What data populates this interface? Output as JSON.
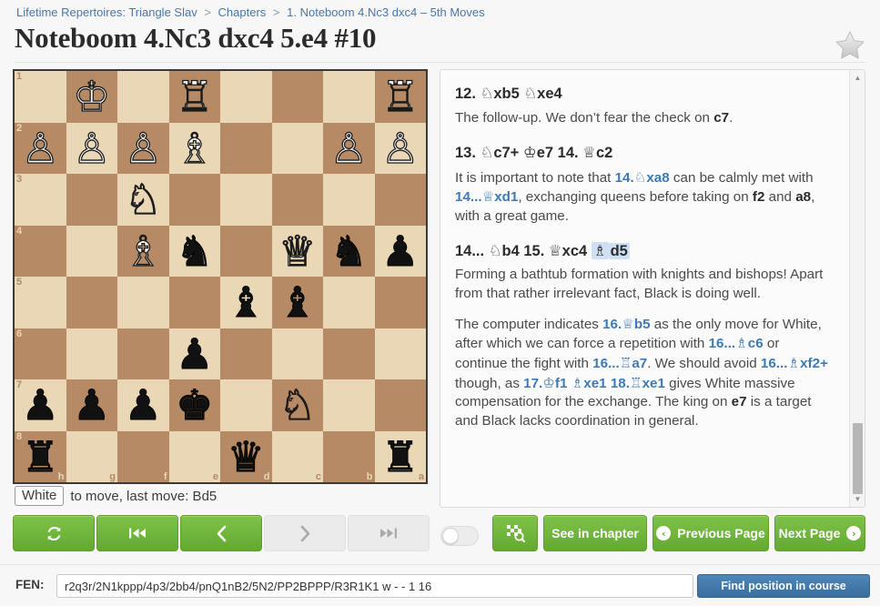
{
  "breadcrumb": {
    "items": [
      "Lifetime Repertoires: Triangle Slav",
      "Chapters",
      "1. Noteboom 4.Nc3 dxc4 – 5th Moves"
    ],
    "separator": ">"
  },
  "header": {
    "title": "Noteboom 4.Nc3 dxc4 5.e4 #10",
    "star_icon": "star-icon"
  },
  "board": {
    "orientation": "black",
    "light_color": "#e9d7b6",
    "dark_color": "#b58a64",
    "rank_labels": [
      "1",
      "2",
      "3",
      "4",
      "5",
      "6",
      "7",
      "8"
    ],
    "file_labels": [
      "h",
      "g",
      "f",
      "e",
      "d",
      "c",
      "b",
      "a"
    ],
    "rows": [
      [
        ".",
        "K",
        ".",
        "R",
        ".",
        ".",
        ".",
        "R"
      ],
      [
        "P",
        "P",
        "P",
        "B",
        ".",
        ".",
        "P",
        "P"
      ],
      [
        ".",
        ".",
        "N",
        ".",
        ".",
        ".",
        ".",
        "."
      ],
      [
        ".",
        ".",
        "B",
        "n",
        ".",
        "Q",
        "n",
        "p"
      ],
      [
        ".",
        ".",
        ".",
        ".",
        "b",
        "b",
        ".",
        "."
      ],
      [
        ".",
        ".",
        ".",
        "p",
        ".",
        ".",
        ".",
        "."
      ],
      [
        "p",
        "p",
        "p",
        "k",
        ".",
        "N",
        ".",
        "."
      ],
      [
        "r",
        ".",
        ".",
        ".",
        "q",
        ".",
        ".",
        "r"
      ]
    ]
  },
  "status": {
    "side_to_move": "White",
    "text": "to move, last move: Bd5"
  },
  "controls": [
    {
      "name": "flip-board-button",
      "icon": "refresh-icon",
      "enabled": true
    },
    {
      "name": "first-move-button",
      "icon": "skip-back-icon",
      "enabled": true
    },
    {
      "name": "previous-move-button",
      "icon": "chevron-left-icon",
      "enabled": true
    },
    {
      "name": "next-move-button",
      "icon": "chevron-right-icon",
      "enabled": false
    },
    {
      "name": "last-move-button",
      "icon": "skip-forward-icon",
      "enabled": false
    }
  ],
  "toggle": {
    "name": "engine-toggle",
    "state": "off"
  },
  "actions": {
    "find_on_board_icon": "board-search-icon",
    "see_in_chapter": "See in chapter",
    "previous_page": "Previous Page",
    "next_page": "Next Page",
    "prev_arrow": "‹",
    "next_arrow": "›"
  },
  "notation": {
    "blocks": [
      {
        "type": "moves",
        "parts": [
          {
            "t": "12. ",
            "s": "num"
          },
          {
            "t": "♘",
            "s": "glyph"
          },
          {
            "t": "xb5 ",
            "s": "plain"
          },
          {
            "t": "♘",
            "s": "glyph"
          },
          {
            "t": "xe4",
            "s": "plain"
          }
        ]
      },
      {
        "type": "comment",
        "parts": [
          {
            "t": "The follow-up. We don’t fear the check on ",
            "s": "plain"
          },
          {
            "t": "c7",
            "s": "sqref"
          },
          {
            "t": ".",
            "s": "plain"
          }
        ]
      },
      {
        "type": "moves",
        "parts": [
          {
            "t": "13. ",
            "s": "num"
          },
          {
            "t": "♘",
            "s": "glyph"
          },
          {
            "t": "c7+ ",
            "s": "plain"
          },
          {
            "t": "♔",
            "s": "glyph"
          },
          {
            "t": "e7 14. ",
            "s": "plain"
          },
          {
            "t": "♕",
            "s": "glyph"
          },
          {
            "t": "c2",
            "s": "plain"
          }
        ]
      },
      {
        "type": "comment",
        "parts": [
          {
            "t": "It is important to note that ",
            "s": "plain"
          },
          {
            "t": "14.",
            "s": "mv"
          },
          {
            "t": "♘",
            "s": "mv-glyph"
          },
          {
            "t": "xa8",
            "s": "mv"
          },
          {
            "t": " can be calmly met with ",
            "s": "plain"
          },
          {
            "t": "14...",
            "s": "mv"
          },
          {
            "t": "♕",
            "s": "mv-glyph"
          },
          {
            "t": "xd1",
            "s": "mv"
          },
          {
            "t": ", exchanging queens before taking on ",
            "s": "plain"
          },
          {
            "t": "f2",
            "s": "sqref"
          },
          {
            "t": " and ",
            "s": "plain"
          },
          {
            "t": "a8",
            "s": "sqref"
          },
          {
            "t": ", with a great game.",
            "s": "plain"
          }
        ]
      },
      {
        "type": "moves",
        "parts": [
          {
            "t": "14... ",
            "s": "num"
          },
          {
            "t": "♘",
            "s": "glyph"
          },
          {
            "t": "b4 15. ",
            "s": "plain"
          },
          {
            "t": "♕",
            "s": "glyph"
          },
          {
            "t": "xc4 ",
            "s": "plain"
          },
          {
            "t": "♗",
            "s": "glyph-hl"
          },
          {
            "t": "d5",
            "s": "plain-hl"
          }
        ]
      },
      {
        "type": "comment",
        "parts": [
          {
            "t": "Forming a bathtub formation with knights and bishops! Apart from that rather irrelevant fact, Black is doing well.",
            "s": "plain"
          }
        ]
      },
      {
        "type": "comment",
        "parts": [
          {
            "t": "The computer indicates ",
            "s": "plain"
          },
          {
            "t": "16.",
            "s": "mv"
          },
          {
            "t": "♕",
            "s": "mv-glyph"
          },
          {
            "t": "b5",
            "s": "mv"
          },
          {
            "t": " as the only move for White, after which we can force a repetition with ",
            "s": "plain"
          },
          {
            "t": "16...",
            "s": "mv"
          },
          {
            "t": "♗",
            "s": "mv-glyph"
          },
          {
            "t": "c6",
            "s": "mv"
          },
          {
            "t": " or continue the fight with ",
            "s": "plain"
          },
          {
            "t": "16...",
            "s": "mv"
          },
          {
            "t": "♖",
            "s": "mv-glyph"
          },
          {
            "t": "a7",
            "s": "mv"
          },
          {
            "t": ". We should avoid ",
            "s": "plain"
          },
          {
            "t": "16...",
            "s": "mv"
          },
          {
            "t": "♗",
            "s": "mv-glyph"
          },
          {
            "t": "xf2+",
            "s": "mv"
          },
          {
            "t": " though, as ",
            "s": "plain"
          },
          {
            "t": "17.",
            "s": "mv"
          },
          {
            "t": "♔",
            "s": "mv-glyph"
          },
          {
            "t": "f1 ",
            "s": "mv"
          },
          {
            "t": "♗",
            "s": "mv-glyph"
          },
          {
            "t": "xe1 18.",
            "s": "mv"
          },
          {
            "t": "♖",
            "s": "mv-glyph"
          },
          {
            "t": "xe1",
            "s": "mv"
          },
          {
            "t": " gives White massive compensation for the exchange. The king on ",
            "s": "plain"
          },
          {
            "t": "e7",
            "s": "sqref"
          },
          {
            "t": " is a target and Black lacks coordination in general.",
            "s": "plain"
          }
        ]
      }
    ],
    "scrollbar": {
      "up_arrow": "▲",
      "down_arrow": "▼"
    }
  },
  "fen": {
    "label": "FEN:",
    "value": "r2q3r/2N1kppp/4p3/2bb4/pnQ1nB2/5N2/PP2BPPP/R3R1K1 w - - 1 16",
    "placeholder": "FEN",
    "button": "Find position in course"
  }
}
